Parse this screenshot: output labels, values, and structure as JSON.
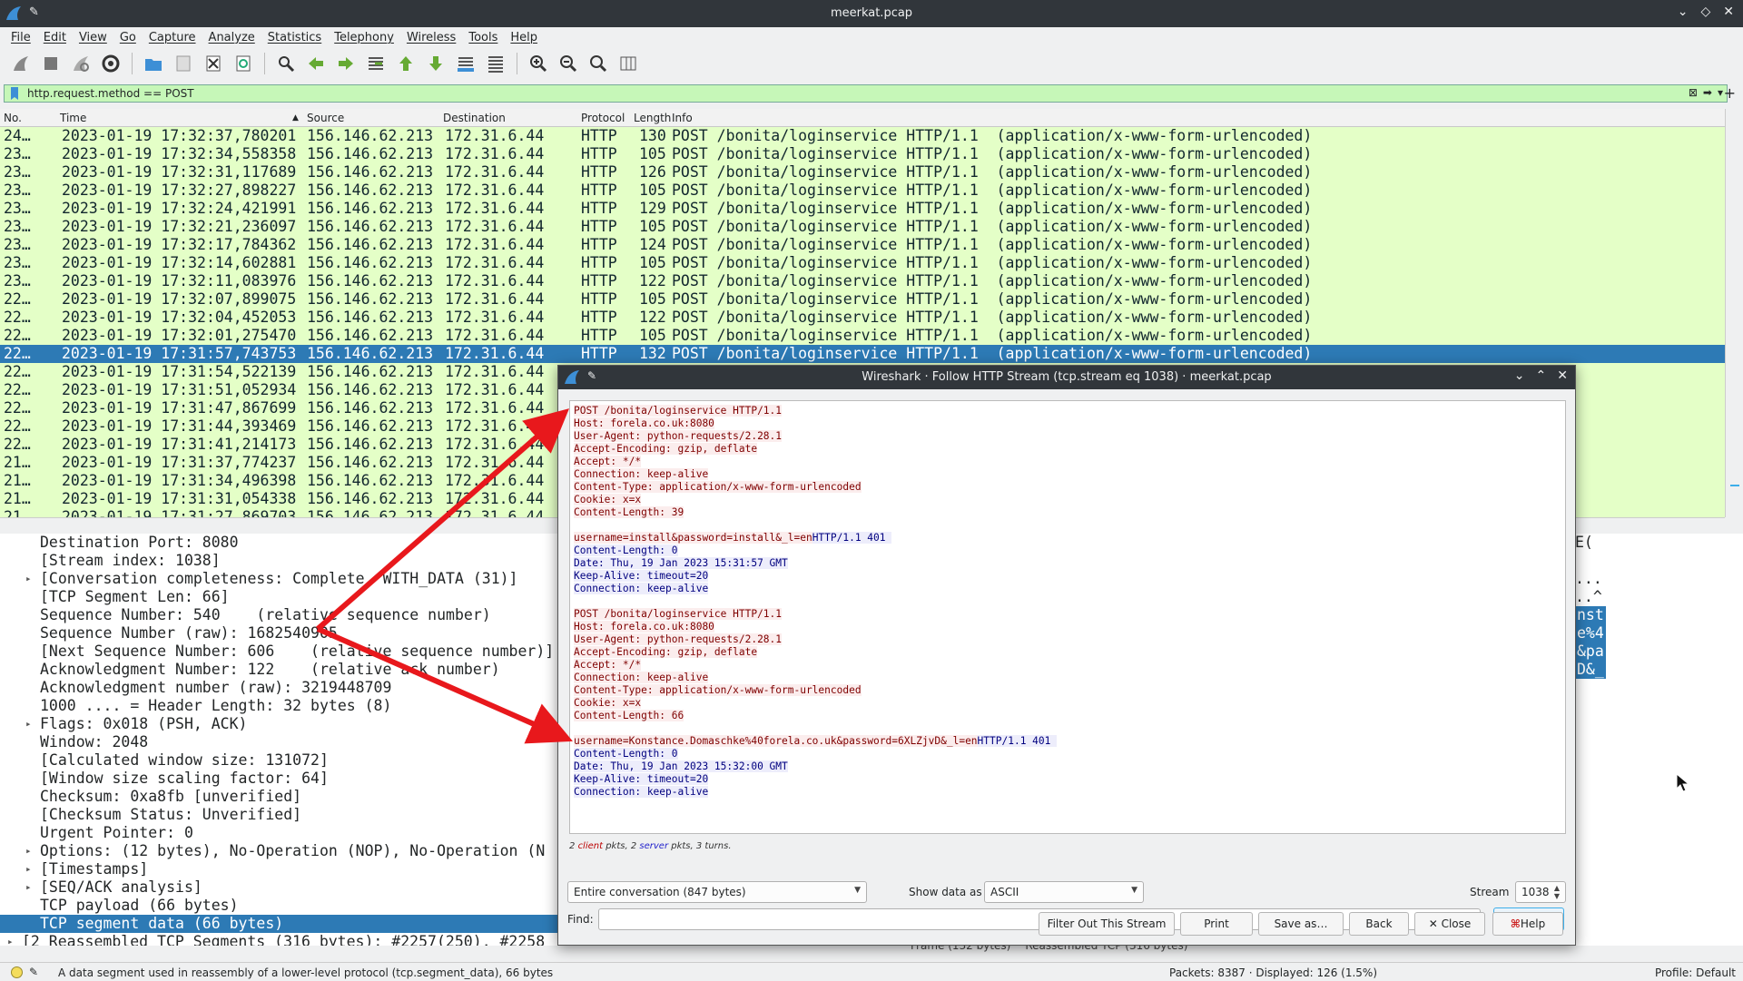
{
  "window": {
    "title": "meerkat.pcap"
  },
  "menubar": [
    "File",
    "Edit",
    "View",
    "Go",
    "Capture",
    "Analyze",
    "Statistics",
    "Telephony",
    "Wireless",
    "Tools",
    "Help"
  ],
  "filter": {
    "value": "http.request.method  == POST"
  },
  "packet_list": {
    "columns": [
      "No.",
      "Time",
      "Source",
      "Destination",
      "Protocol",
      "Length",
      "Info"
    ],
    "rows": [
      {
        "no": "24…",
        "time": "2023-01-19 17:32:37,780201",
        "src": "156.146.62.213",
        "dst": "172.31.6.44",
        "proto": "HTTP",
        "len": "130",
        "info": "POST /bonita/loginservice HTTP/1.1  (application/x-www-form-urlencoded)"
      },
      {
        "no": "23…",
        "time": "2023-01-19 17:32:34,558358",
        "src": "156.146.62.213",
        "dst": "172.31.6.44",
        "proto": "HTTP",
        "len": "105",
        "info": "POST /bonita/loginservice HTTP/1.1  (application/x-www-form-urlencoded)"
      },
      {
        "no": "23…",
        "time": "2023-01-19 17:32:31,117689",
        "src": "156.146.62.213",
        "dst": "172.31.6.44",
        "proto": "HTTP",
        "len": "126",
        "info": "POST /bonita/loginservice HTTP/1.1  (application/x-www-form-urlencoded)"
      },
      {
        "no": "23…",
        "time": "2023-01-19 17:32:27,898227",
        "src": "156.146.62.213",
        "dst": "172.31.6.44",
        "proto": "HTTP",
        "len": "105",
        "info": "POST /bonita/loginservice HTTP/1.1  (application/x-www-form-urlencoded)"
      },
      {
        "no": "23…",
        "time": "2023-01-19 17:32:24,421991",
        "src": "156.146.62.213",
        "dst": "172.31.6.44",
        "proto": "HTTP",
        "len": "129",
        "info": "POST /bonita/loginservice HTTP/1.1  (application/x-www-form-urlencoded)"
      },
      {
        "no": "23…",
        "time": "2023-01-19 17:32:21,236097",
        "src": "156.146.62.213",
        "dst": "172.31.6.44",
        "proto": "HTTP",
        "len": "105",
        "info": "POST /bonita/loginservice HTTP/1.1  (application/x-www-form-urlencoded)"
      },
      {
        "no": "23…",
        "time": "2023-01-19 17:32:17,784362",
        "src": "156.146.62.213",
        "dst": "172.31.6.44",
        "proto": "HTTP",
        "len": "124",
        "info": "POST /bonita/loginservice HTTP/1.1  (application/x-www-form-urlencoded)"
      },
      {
        "no": "23…",
        "time": "2023-01-19 17:32:14,602881",
        "src": "156.146.62.213",
        "dst": "172.31.6.44",
        "proto": "HTTP",
        "len": "105",
        "info": "POST /bonita/loginservice HTTP/1.1  (application/x-www-form-urlencoded)"
      },
      {
        "no": "23…",
        "time": "2023-01-19 17:32:11,083976",
        "src": "156.146.62.213",
        "dst": "172.31.6.44",
        "proto": "HTTP",
        "len": "122",
        "info": "POST /bonita/loginservice HTTP/1.1  (application/x-www-form-urlencoded)"
      },
      {
        "no": "22…",
        "time": "2023-01-19 17:32:07,899075",
        "src": "156.146.62.213",
        "dst": "172.31.6.44",
        "proto": "HTTP",
        "len": "105",
        "info": "POST /bonita/loginservice HTTP/1.1  (application/x-www-form-urlencoded)"
      },
      {
        "no": "22…",
        "time": "2023-01-19 17:32:04,452053",
        "src": "156.146.62.213",
        "dst": "172.31.6.44",
        "proto": "HTTP",
        "len": "122",
        "info": "POST /bonita/loginservice HTTP/1.1  (application/x-www-form-urlencoded)"
      },
      {
        "no": "22…",
        "time": "2023-01-19 17:32:01,275470",
        "src": "156.146.62.213",
        "dst": "172.31.6.44",
        "proto": "HTTP",
        "len": "105",
        "info": "POST /bonita/loginservice HTTP/1.1  (application/x-www-form-urlencoded)"
      },
      {
        "no": "22…",
        "time": "2023-01-19 17:31:57,743753",
        "src": "156.146.62.213",
        "dst": "172.31.6.44",
        "proto": "HTTP",
        "len": "132",
        "info": "POST /bonita/loginservice HTTP/1.1  (application/x-www-form-urlencoded)"
      },
      {
        "no": "22…",
        "time": "2023-01-19 17:31:54,522139",
        "src": "156.146.62.213",
        "dst": "172.31.6.44",
        "proto": "",
        "len": "",
        "info": ""
      },
      {
        "no": "22…",
        "time": "2023-01-19 17:31:51,052934",
        "src": "156.146.62.213",
        "dst": "172.31.6.44",
        "proto": "",
        "len": "",
        "info": ""
      },
      {
        "no": "22…",
        "time": "2023-01-19 17:31:47,867699",
        "src": "156.146.62.213",
        "dst": "172.31.6.44",
        "proto": "",
        "len": "",
        "info": ""
      },
      {
        "no": "22…",
        "time": "2023-01-19 17:31:44,393469",
        "src": "156.146.62.213",
        "dst": "172.31.6.44",
        "proto": "",
        "len": "",
        "info": ""
      },
      {
        "no": "22…",
        "time": "2023-01-19 17:31:41,214173",
        "src": "156.146.62.213",
        "dst": "172.31.6.44",
        "proto": "",
        "len": "",
        "info": ""
      },
      {
        "no": "21…",
        "time": "2023-01-19 17:31:37,774237",
        "src": "156.146.62.213",
        "dst": "172.31.6.44",
        "proto": "",
        "len": "",
        "info": ""
      },
      {
        "no": "21…",
        "time": "2023-01-19 17:31:34,496398",
        "src": "156.146.62.213",
        "dst": "172.31.6.44",
        "proto": "",
        "len": "",
        "info": ""
      },
      {
        "no": "21…",
        "time": "2023-01-19 17:31:31,054338",
        "src": "156.146.62.213",
        "dst": "172.31.6.44",
        "proto": "",
        "len": "",
        "info": ""
      },
      {
        "no": "21…",
        "time": "2023-01-19 17:31:27,869703",
        "src": "156.146.62.213",
        "dst": "172.31.6.44",
        "proto": "",
        "len": "",
        "info": ""
      }
    ],
    "selected_index": 12
  },
  "details": [
    {
      "indent": 1,
      "text": "Destination Port: 8080",
      "expand": false
    },
    {
      "indent": 1,
      "text": "[Stream index: 1038]",
      "expand": false
    },
    {
      "indent": 1,
      "text": "[Conversation completeness: Complete, WITH_DATA (31)]",
      "expand": true
    },
    {
      "indent": 1,
      "text": "[TCP Segment Len: 66]",
      "expand": false
    },
    {
      "indent": 1,
      "text": "Sequence Number: 540    (relative sequence number)",
      "expand": false
    },
    {
      "indent": 1,
      "text": "Sequence Number (raw): 1682540905",
      "expand": false
    },
    {
      "indent": 1,
      "text": "[Next Sequence Number: 606    (relative sequence number)]",
      "expand": false
    },
    {
      "indent": 1,
      "text": "Acknowledgment Number: 122    (relative ack number)",
      "expand": false
    },
    {
      "indent": 1,
      "text": "Acknowledgment number (raw): 3219448709",
      "expand": false
    },
    {
      "indent": 1,
      "text": "1000 .... = Header Length: 32 bytes (8)",
      "expand": false
    },
    {
      "indent": 1,
      "text": "Flags: 0x018 (PSH, ACK)",
      "expand": true
    },
    {
      "indent": 1,
      "text": "Window: 2048",
      "expand": false
    },
    {
      "indent": 1,
      "text": "[Calculated window size: 131072]",
      "expand": false
    },
    {
      "indent": 1,
      "text": "[Window size scaling factor: 64]",
      "expand": false
    },
    {
      "indent": 1,
      "text": "Checksum: 0xa8fb [unverified]",
      "expand": false
    },
    {
      "indent": 1,
      "text": "[Checksum Status: Unverified]",
      "expand": false
    },
    {
      "indent": 1,
      "text": "Urgent Pointer: 0",
      "expand": false
    },
    {
      "indent": 1,
      "text": "Options: (12 bytes), No-Operation (NOP), No-Operation (N",
      "expand": true
    },
    {
      "indent": 1,
      "text": "[Timestamps]",
      "expand": true
    },
    {
      "indent": 1,
      "text": "[SEQ/ACK analysis]",
      "expand": true
    },
    {
      "indent": 1,
      "text": "TCP payload (66 bytes)",
      "expand": false
    },
    {
      "indent": 1,
      "text": "TCP segment data (66 bytes)",
      "expand": false,
      "selected": true
    },
    {
      "indent": 0,
      "text": "[2 Reassembled TCP Segments (316 bytes): #2257(250), #2258",
      "expand": true
    }
  ],
  "hex": [
    {
      "text": "E(",
      "sel": false
    },
    {
      "text": "",
      "sel": false
    },
    {
      "text": "...",
      "sel": false
    },
    {
      "text": "..^",
      "sel": false
    },
    {
      "text": "nst",
      "sel": true
    },
    {
      "text": "e%4",
      "sel": true
    },
    {
      "text": "&pa",
      "sel": true
    },
    {
      "text": "D&_",
      "sel": true
    }
  ],
  "bottom_tabs": [
    "Frame (132 bytes)",
    "Reassembled TCP (316 bytes)"
  ],
  "status": {
    "message": "A data segment used in reassembly of a lower-level protocol (tcp.segment_data), 66 bytes",
    "packets": "Packets: 8387 · Displayed: 126 (1.5%)",
    "profile": "Profile: Default"
  },
  "dialog": {
    "title": "Wireshark · Follow HTTP Stream (tcp.stream eq 1038) · meerkat.pcap",
    "stream": [
      {
        "t": "c",
        "text": "POST /bonita/loginservice HTTP/1.1"
      },
      {
        "t": "c",
        "text": "Host: forela.co.uk:8080"
      },
      {
        "t": "c",
        "text": "User-Agent: python-requests/2.28.1"
      },
      {
        "t": "c",
        "text": "Accept-Encoding: gzip, deflate"
      },
      {
        "t": "c",
        "text": "Accept: */*"
      },
      {
        "t": "c",
        "text": "Connection: keep-alive"
      },
      {
        "t": "c",
        "text": "Content-Type: application/x-www-form-urlencoded"
      },
      {
        "t": "c",
        "text": "Cookie: x=x"
      },
      {
        "t": "c",
        "text": "Content-Length: 39"
      },
      {
        "t": "b",
        "text": ""
      },
      {
        "t": "cs",
        "text": "username=install&password=install&_l=en",
        "text2": "HTTP/1.1 401 "
      },
      {
        "t": "s",
        "text": "Content-Length: 0"
      },
      {
        "t": "s",
        "text": "Date: Thu, 19 Jan 2023 15:31:57 GMT"
      },
      {
        "t": "s",
        "text": "Keep-Alive: timeout=20"
      },
      {
        "t": "s",
        "text": "Connection: keep-alive"
      },
      {
        "t": "b",
        "text": ""
      },
      {
        "t": "c",
        "text": "POST /bonita/loginservice HTTP/1.1"
      },
      {
        "t": "c",
        "text": "Host: forela.co.uk:8080"
      },
      {
        "t": "c",
        "text": "User-Agent: python-requests/2.28.1"
      },
      {
        "t": "c",
        "text": "Accept-Encoding: gzip, deflate"
      },
      {
        "t": "c",
        "text": "Accept: */*"
      },
      {
        "t": "c",
        "text": "Connection: keep-alive"
      },
      {
        "t": "c",
        "text": "Content-Type: application/x-www-form-urlencoded"
      },
      {
        "t": "c",
        "text": "Cookie: x=x"
      },
      {
        "t": "c",
        "text": "Content-Length: 66"
      },
      {
        "t": "b",
        "text": ""
      },
      {
        "t": "cs",
        "text": "username=Konstance.Domaschke%40forela.co.uk&password=6XLZjvD&_l=en",
        "text2": "HTTP/1.1 401 "
      },
      {
        "t": "s",
        "text": "Content-Length: 0"
      },
      {
        "t": "s",
        "text": "Date: Thu, 19 Jan 2023 15:32:00 GMT"
      },
      {
        "t": "s",
        "text": "Keep-Alive: timeout=20"
      },
      {
        "t": "s",
        "text": "Connection: keep-alive"
      }
    ],
    "stats": {
      "client_n": "2",
      "client_word": "client",
      "mid1": " pkts, ",
      "server_n": "2",
      "server_word": "server",
      "mid2": " pkts, 3 turns."
    },
    "conversation": "Entire conversation (847 bytes)",
    "show_data_label": "Show data as",
    "show_data_value": "ASCII",
    "stream_label": "Stream",
    "stream_value": "1038",
    "find_label": "Find:",
    "find_value": "",
    "find_next": "Find Next",
    "buttons": {
      "filter_out": "Filter Out This Stream",
      "print": "Print",
      "save_as": "Save as…",
      "back": "Back",
      "close": "Close",
      "help": "Help"
    }
  }
}
